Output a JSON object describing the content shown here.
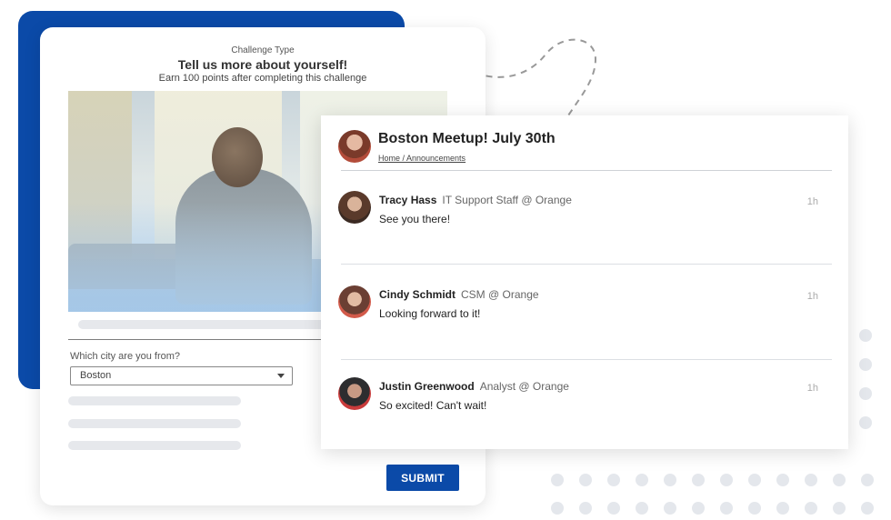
{
  "challenge": {
    "type_label": "Challenge Type",
    "title": "Tell us more about yourself!",
    "subtitle": "Earn 100 points after completing this challenge",
    "city_question": "Which city are you from?",
    "city_value": "Boston",
    "submit_label": "SUBMIT"
  },
  "announcement": {
    "title": "Boston Meetup! July 30th",
    "breadcrumb": "Home / Announcements",
    "posts": [
      {
        "name": "Tracy Hass",
        "role": "IT Support Staff @ Orange",
        "message": "See you there!",
        "time": "1h"
      },
      {
        "name": "Cindy Schmidt",
        "role": "CSM @ Orange",
        "message": "Looking forward to it!",
        "time": "1h"
      },
      {
        "name": "Justin Greenwood",
        "role": "Analyst @ Orange",
        "message": "So excited! Can't wait!",
        "time": "1h"
      }
    ]
  },
  "colors": {
    "brand_blue": "#0b4aa8",
    "placeholder_grey": "#e6e8ec",
    "dot_grey": "#e4e7ec"
  },
  "icons": {
    "dropdown": "chevron-down-icon"
  }
}
